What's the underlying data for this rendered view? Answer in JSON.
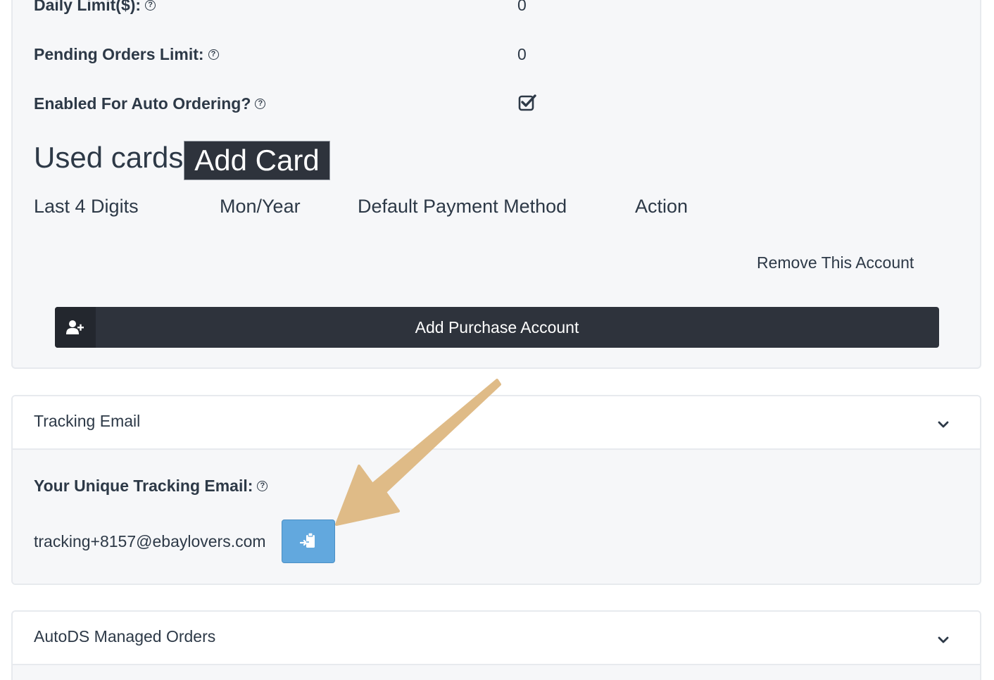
{
  "account_settings": {
    "daily_limit": {
      "label": "Daily Limit($):",
      "value": "0"
    },
    "pending_orders_limit": {
      "label": "Pending Orders Limit:",
      "value": "0"
    },
    "auto_ordering": {
      "label": "Enabled For Auto Ordering?",
      "checked": true
    },
    "help_glyph": "?"
  },
  "used_cards": {
    "title": "Used cards",
    "add_card_label": "Add Card",
    "columns": [
      "Last 4 Digits",
      "Mon/Year",
      "Default Payment Method",
      "Action"
    ]
  },
  "remove_account_label": "Remove This Account",
  "add_purchase_account_label": "Add Purchase Account",
  "tracking_panel": {
    "title": "Tracking Email",
    "unique_email_label": "Your Unique Tracking Email:",
    "email": "tracking+8157@ebaylovers.com",
    "copy_button_icon": "clipboard-paste-icon"
  },
  "managed_orders_panel": {
    "title": "AutoDS Managed Orders"
  },
  "colors": {
    "dark_button": "#2e333c",
    "copy_button": "#62a8de",
    "annotation_arrow": "#dfbb87",
    "panel_bg": "#f6f7f9",
    "border": "#e7eaee"
  }
}
